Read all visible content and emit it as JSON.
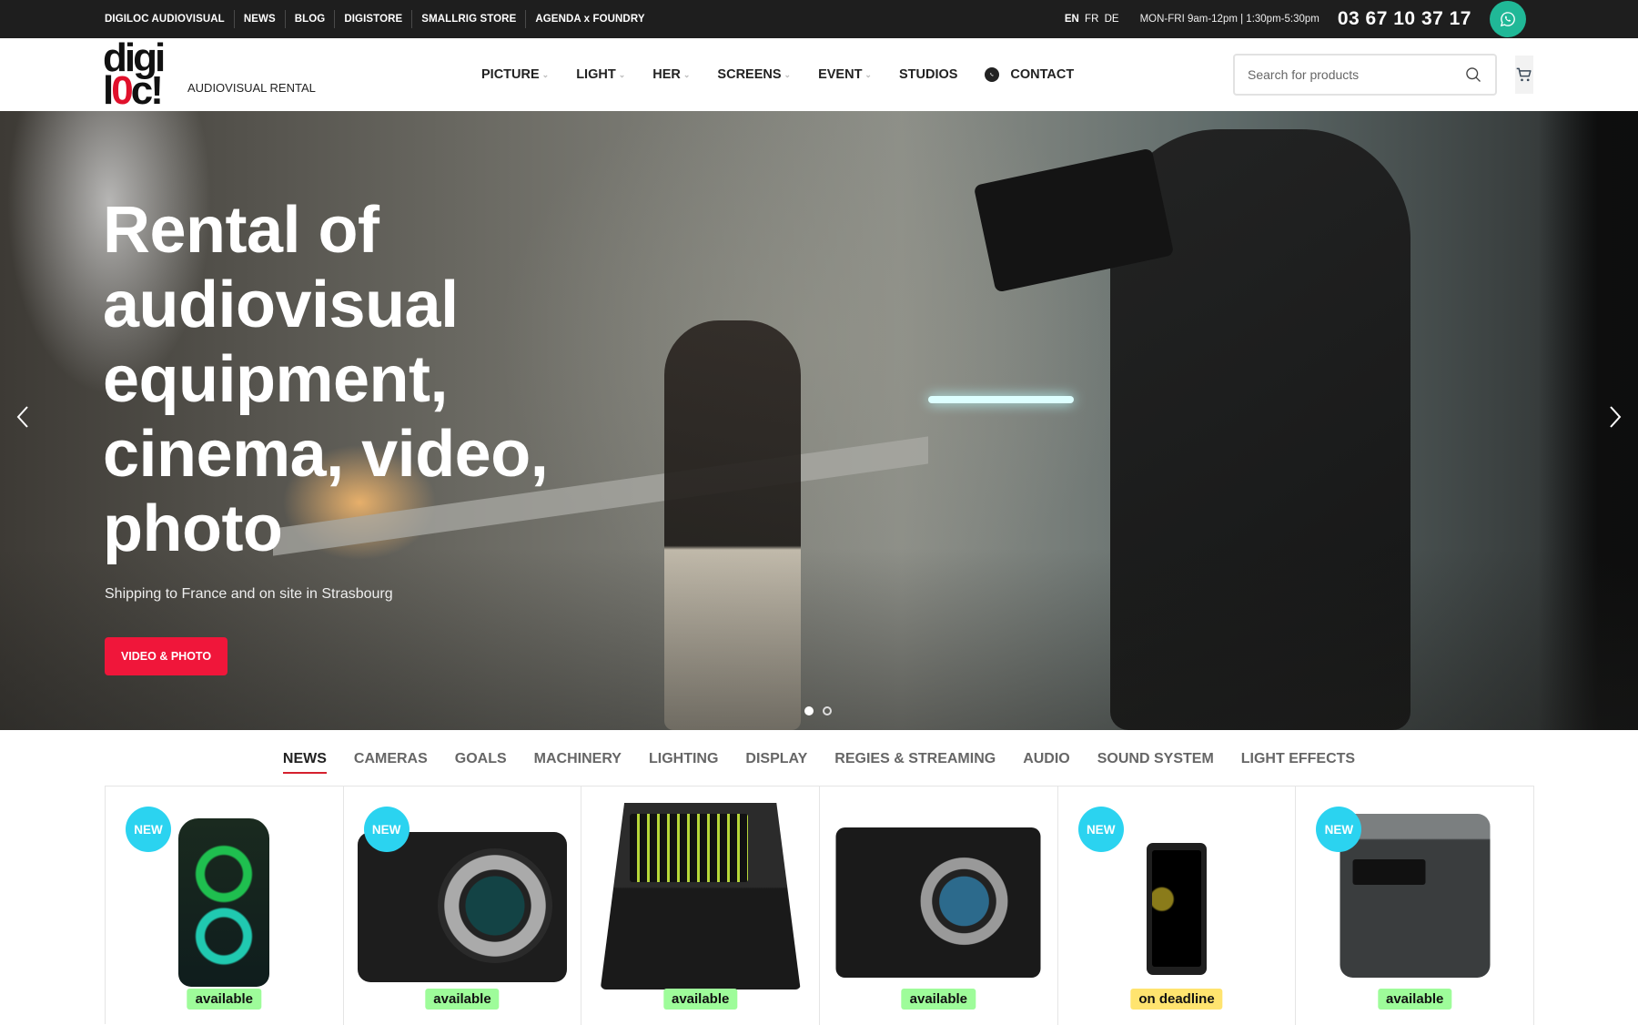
{
  "topbar": {
    "links": [
      "DIGILOC AUDIOVISUAL",
      "NEWS",
      "BLOG",
      "DIGISTORE",
      "SMALLRIG STORE",
      "AGENDA x FOUNDRY"
    ],
    "languages": [
      {
        "code": "EN",
        "active": true
      },
      {
        "code": "FR",
        "active": false
      },
      {
        "code": "DE",
        "active": false
      }
    ],
    "hours": "MON-FRI 9am-12pm | 1:30pm-5:30pm",
    "phone": "03 67 10 37 17",
    "whatsapp_icon": "whatsapp-icon"
  },
  "header": {
    "logo_line1": "digi",
    "logo_line2_a": "l",
    "logo_line2_zero": "0",
    "logo_line2_b": "c!",
    "tagline": "AUDIOVISUAL RENTAL",
    "nav": [
      {
        "label": "PICTURE",
        "dropdown": true
      },
      {
        "label": "LIGHT",
        "dropdown": true
      },
      {
        "label": "HER",
        "dropdown": true
      },
      {
        "label": "SCREENS",
        "dropdown": true
      },
      {
        "label": "EVENT",
        "dropdown": true
      },
      {
        "label": "STUDIOS",
        "dropdown": false
      },
      {
        "label": "CONTACT",
        "dropdown": false,
        "icon": "whatsapp-icon"
      }
    ],
    "search_placeholder": "Search for products",
    "search_value": "",
    "cart_icon": "cart-icon"
  },
  "hero": {
    "title": "Rental of audiovisual equipment, cinema, video, photo",
    "subtitle": "Shipping to France and on site in Strasbourg",
    "button_label": "VIDEO & PHOTO",
    "slides_total": 2,
    "active_slide": 1,
    "accent_color": "#f0163a"
  },
  "category_tabs": {
    "active_index": 0,
    "items": [
      "NEWS",
      "CAMERAS",
      "GOALS",
      "MACHINERY",
      "LIGHTING",
      "DISPLAY",
      "REGIES & STREAMING",
      "AUDIO",
      "SOUND SYSTEM",
      "LIGHT EFFECTS"
    ]
  },
  "products": [
    {
      "badge": "NEW",
      "status": "available",
      "status_type": "available",
      "image": "jbl-partybox-speaker"
    },
    {
      "badge": "NEW",
      "status": "available",
      "status_type": "available",
      "image": "canon-eos-r5-camera"
    },
    {
      "badge": "",
      "status": "available",
      "status_type": "available",
      "image": "mackie-dlz-mixer"
    },
    {
      "badge": "",
      "status": "available",
      "status_type": "available",
      "image": "sony-alpha-7r-camera"
    },
    {
      "badge": "NEW",
      "status": "on deadline",
      "status_type": "deadline",
      "image": "5g-mobile-device"
    },
    {
      "badge": "NEW",
      "status": "available",
      "status_type": "available",
      "image": "ecoflow-delta-power-station"
    }
  ],
  "colors": {
    "topbar_bg": "#1e1e1e",
    "whatsapp_green": "#20b897",
    "new_badge": "#2bd3f0",
    "available": "#9efc9a",
    "deadline": "#ffe46f",
    "tab_underline": "#d5202e"
  }
}
